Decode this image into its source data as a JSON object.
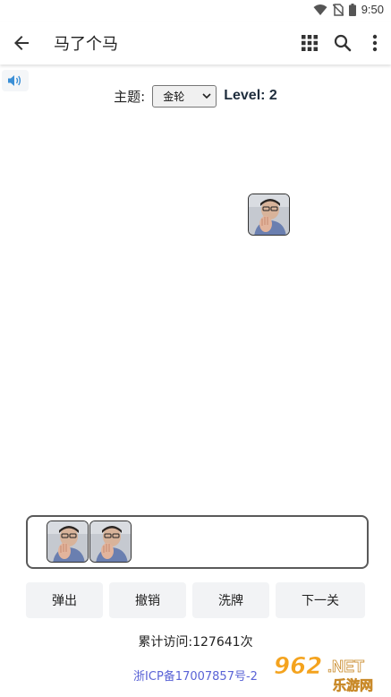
{
  "status_bar": {
    "time": "9:50",
    "icons": [
      "wifi-icon",
      "no-sim-icon",
      "battery-icon"
    ]
  },
  "app_bar": {
    "title": "马了个马",
    "icons": [
      "back-arrow-icon",
      "grid-icon",
      "search-icon",
      "more-vert-icon"
    ]
  },
  "sound": {
    "icon": "speaker-icon"
  },
  "theme": {
    "label": "主题:",
    "selected": "金轮",
    "level_text": "Level: 2"
  },
  "board": {
    "tiles": [
      {
        "icon": "person-photo-tile"
      }
    ]
  },
  "slot": {
    "tiles": [
      {
        "icon": "person-photo-tile"
      },
      {
        "icon": "person-photo-tile"
      }
    ]
  },
  "actions": [
    {
      "label": "弹出"
    },
    {
      "label": "撤销"
    },
    {
      "label": "洗牌"
    },
    {
      "label": "下一关"
    }
  ],
  "footer": {
    "visits": "累计访问:127641次",
    "icp": "浙ICP备17007857号-2"
  },
  "watermark": {
    "main": "962",
    "suffix": ".NET",
    "sub": "乐游网"
  },
  "colors": {
    "accent": "#5a63d6",
    "level_text": "#1f2d3d",
    "button_bg": "#f2f3f5"
  }
}
